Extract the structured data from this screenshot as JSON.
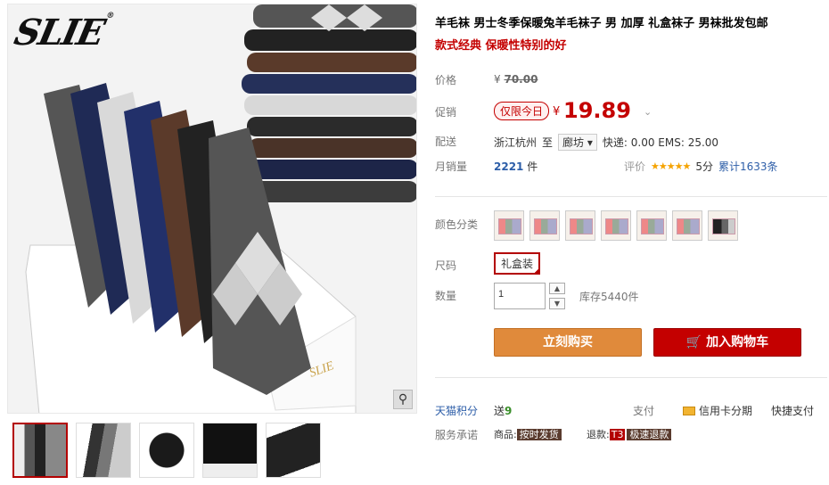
{
  "gallery": {
    "brand": "SLIE",
    "brand_mark": "®",
    "zoom_icon": "magnifier-icon",
    "box_text": "SLIE",
    "thumbnails": [
      "thumb-1",
      "thumb-2",
      "thumb-3",
      "thumb-4",
      "thumb-5"
    ]
  },
  "product": {
    "title": "羊毛袜 男士冬季保暖兔羊毛袜子 男 加厚 礼盒袜子 男袜批发包邮",
    "subtitle": "款式经典 保暖性特别的好"
  },
  "price": {
    "label": "价格",
    "currency": "¥",
    "original": "70.00"
  },
  "promo": {
    "label": "促销",
    "badge": "仅限今日",
    "currency": "¥",
    "value": "19.89",
    "dropdown_icon": "⌄"
  },
  "shipping": {
    "label": "配送",
    "from": "浙江杭州",
    "to_word": "至",
    "to_city": "廊坊",
    "fee": "快递: 0.00 EMS: 25.00"
  },
  "sales": {
    "label": "月销量",
    "count": "2221",
    "unit": "件",
    "rating_label": "评价",
    "stars": "★★★★★",
    "score": "5分",
    "total": "累计1633条"
  },
  "options": {
    "color_label": "颜色分类",
    "size_label": "尺码",
    "size_value": "礼盒装",
    "qty_label": "数量",
    "qty_value": "1",
    "qty_up": "▲",
    "qty_down": "▼",
    "stock": "库存5440件"
  },
  "actions": {
    "buy": "立刻购买",
    "cart": "加入购物车",
    "cart_icon": "🛒"
  },
  "extra": {
    "points_label": "天猫积分",
    "points_prefix": "送",
    "points_value": "9",
    "pay_label": "支付",
    "credit": "信用卡分期",
    "quickpay": "快捷支付",
    "service_label": "服务承诺",
    "svc_goods": "商品:",
    "svc_goods_tag": "按时发货",
    "svc_return": "退款:",
    "svc_return_badge": "T3",
    "svc_return_tag": "极速退款"
  },
  "colors": {
    "accent": "#c40000",
    "buy_bg": "#e08a3b",
    "link": "#2d5ea8"
  }
}
